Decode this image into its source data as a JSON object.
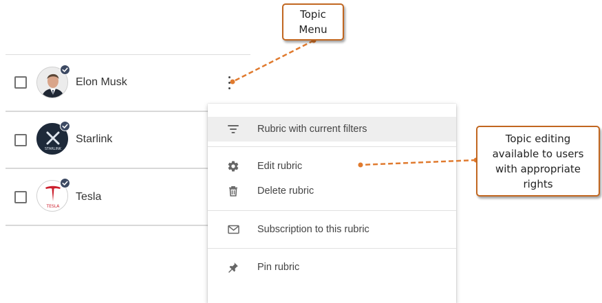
{
  "list": {
    "rows": [
      {
        "name": "Elon Musk",
        "avatar_icon": "person-photo-icon",
        "verified_icon": "verified-check-icon"
      },
      {
        "name": "Starlink",
        "avatar_icon": "starlink-logo-icon",
        "avatar_text": "STARLINK",
        "verified_icon": "verified-check-icon"
      },
      {
        "name": "Tesla",
        "avatar_icon": "tesla-logo-icon",
        "avatar_text": "TESLA",
        "verified_icon": "verified-check-icon"
      }
    ]
  },
  "menu": {
    "items": [
      {
        "label": "Rubric with current filters",
        "icon": "filter-icon"
      },
      {
        "label": "Edit rubric",
        "icon": "gear-icon"
      },
      {
        "label": "Delete rubric",
        "icon": "trash-icon"
      },
      {
        "label": "Subscription to this rubric",
        "icon": "envelope-icon"
      },
      {
        "label": "Pin rubric",
        "icon": "pin-icon"
      }
    ]
  },
  "callouts": {
    "topic_menu": [
      "Topic",
      "Menu"
    ],
    "editing": [
      "Topic editing",
      "available to users",
      "with appropriate",
      "rights"
    ]
  },
  "colors": {
    "callout_border": "#c1661f",
    "arrow": "#e07a2e",
    "badge": "#3d4a63",
    "menu_highlight": "#eeeeee"
  }
}
